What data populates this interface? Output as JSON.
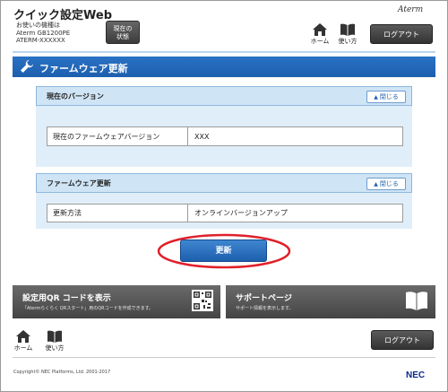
{
  "header": {
    "app_title": "クイック設定Web",
    "model_label": "お使いの機種は",
    "model_name": "Aterm GB1200PE",
    "model_id": "ATERM-XXXXXX",
    "status_button": [
      "現在の",
      "状態"
    ],
    "brand": "Aterm",
    "home_label": "ホーム",
    "howto_label": "使い方",
    "logout_label": "ログアウト"
  },
  "page": {
    "title": "ファームウェア更新"
  },
  "current_version_section": {
    "heading": "現在のバージョン",
    "close_label": "閉じる",
    "row_key": "現在のファームウェアバージョン",
    "row_value": "XXX"
  },
  "firmware_update_section": {
    "heading": "ファームウェア更新",
    "close_label": "閉じる",
    "row_key": "更新方法",
    "row_value": "オンラインバージョンアップ"
  },
  "update_button": "更新",
  "cards": {
    "qr": {
      "title": "設定用QR コードを表示",
      "subtitle": "「Atermらくらく QRスタート」用のQRコードを作成できます。"
    },
    "support": {
      "title": "サポートページ",
      "subtitle": "サポート情報を表示します。"
    }
  },
  "footer": {
    "home_label": "ホーム",
    "howto_label": "使い方",
    "logout_label": "ログアウト",
    "copyright": "Copyright© NEC Platforms, Ltd. 2001-2017",
    "logo": "NEC"
  },
  "colors": {
    "accent_blue": "#1d5fae",
    "section_bg": "#e0eef9",
    "highlight_red": "#e0202a"
  }
}
